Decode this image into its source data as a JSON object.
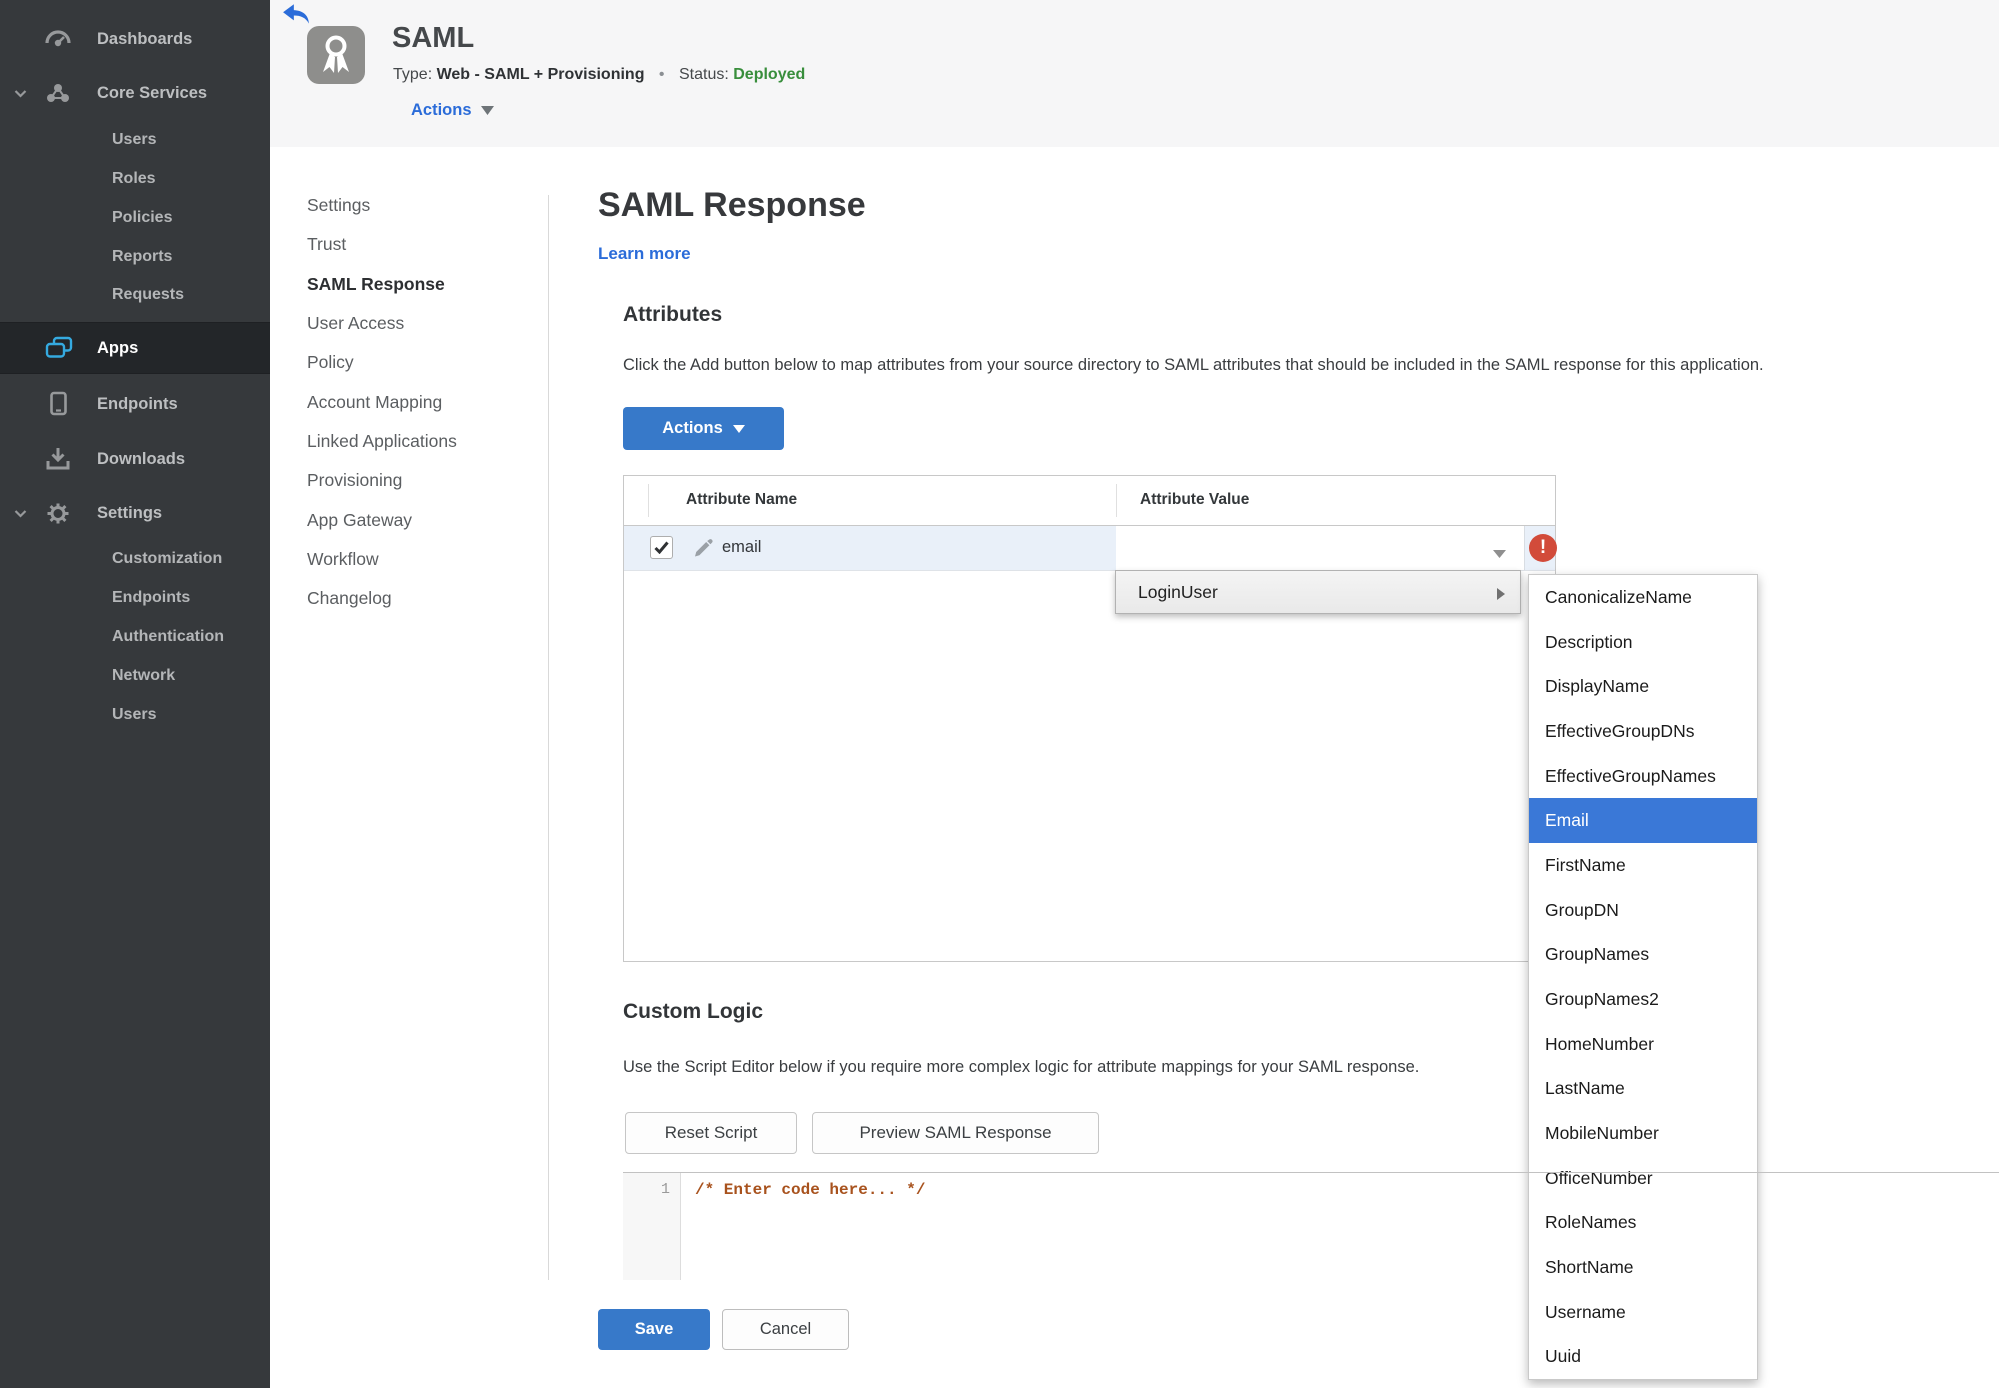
{
  "colors": {
    "accent_blue": "#3779c9",
    "link_blue": "#2b6cd9",
    "status_green": "#388e3c",
    "error_red": "#d24b3a",
    "row_highlight_blue": "#e9f0f9",
    "menu_highlight_blue": "#3a78d7",
    "sidebar_accent_cyan": "#35aae0",
    "sidebar_bg": "#36393c"
  },
  "sidebar": {
    "items": [
      {
        "label": "Dashboards",
        "icon": "gauge-icon",
        "type": "top"
      },
      {
        "label": "Core Services",
        "icon": "core-services-icon",
        "type": "top",
        "expanded": true
      },
      {
        "label": "Users",
        "type": "sub"
      },
      {
        "label": "Roles",
        "type": "sub"
      },
      {
        "label": "Policies",
        "type": "sub"
      },
      {
        "label": "Reports",
        "type": "sub"
      },
      {
        "label": "Requests",
        "type": "sub"
      },
      {
        "label": "Apps",
        "icon": "apps-icon",
        "type": "top",
        "active": true
      },
      {
        "label": "Endpoints",
        "icon": "device-icon",
        "type": "top"
      },
      {
        "label": "Downloads",
        "icon": "download-icon",
        "type": "top"
      },
      {
        "label": "Settings",
        "icon": "gear-icon",
        "type": "top",
        "expanded": true
      },
      {
        "label": "Customization",
        "type": "sub"
      },
      {
        "label": "Endpoints",
        "type": "sub"
      },
      {
        "label": "Authentication",
        "type": "sub"
      },
      {
        "label": "Network",
        "type": "sub"
      },
      {
        "label": "Users",
        "type": "sub"
      }
    ]
  },
  "header": {
    "app_title": "SAML",
    "type_label": "Type:",
    "type_value": "Web - SAML + Provisioning",
    "separator": "•",
    "status_label": "Status:",
    "status_value": "Deployed",
    "actions_label": "Actions"
  },
  "subnav": {
    "items": [
      {
        "label": "Settings"
      },
      {
        "label": "Trust"
      },
      {
        "label": "SAML Response",
        "active": true
      },
      {
        "label": "User Access"
      },
      {
        "label": "Policy"
      },
      {
        "label": "Account Mapping"
      },
      {
        "label": "Linked Applications"
      },
      {
        "label": "Provisioning"
      },
      {
        "label": "App Gateway"
      },
      {
        "label": "Workflow"
      },
      {
        "label": "Changelog"
      }
    ]
  },
  "main": {
    "page_title": "SAML Response",
    "learn_more_label": "Learn more",
    "attributes": {
      "heading": "Attributes",
      "description": "Click the Add button below to map attributes from your source directory to SAML attributes that should be included in the SAML response for this application.",
      "actions_button_label": "Actions",
      "table": {
        "columns": [
          "Attribute Name",
          "Attribute Value"
        ],
        "rows": [
          {
            "name": "email",
            "value": "",
            "checked": true,
            "error": true
          }
        ]
      }
    },
    "value_menu": {
      "label": "LoginUser",
      "submenu_items": [
        {
          "label": "CanonicalizeName"
        },
        {
          "label": "Description"
        },
        {
          "label": "DisplayName"
        },
        {
          "label": "EffectiveGroupDNs"
        },
        {
          "label": "EffectiveGroupNames"
        },
        {
          "label": "Email",
          "selected": true
        },
        {
          "label": "FirstName"
        },
        {
          "label": "GroupDN"
        },
        {
          "label": "GroupNames"
        },
        {
          "label": "GroupNames2"
        },
        {
          "label": "HomeNumber"
        },
        {
          "label": "LastName"
        },
        {
          "label": "MobileNumber"
        },
        {
          "label": "OfficeNumber"
        },
        {
          "label": "RoleNames"
        },
        {
          "label": "ShortName"
        },
        {
          "label": "Username"
        },
        {
          "label": "Uuid"
        }
      ]
    },
    "custom_logic": {
      "heading": "Custom Logic",
      "description": "Use the Script Editor below if you require more complex logic for attribute mappings for your SAML response.",
      "reset_button_label": "Reset Script",
      "preview_button_label": "Preview SAML Response",
      "editor": {
        "line_number": "1",
        "code": "/* Enter code here... */"
      }
    },
    "footer": {
      "save_label": "Save",
      "cancel_label": "Cancel"
    }
  }
}
